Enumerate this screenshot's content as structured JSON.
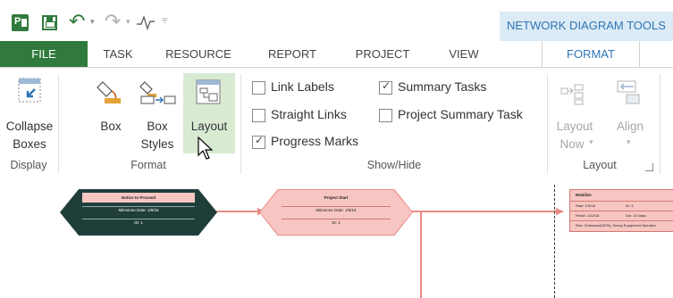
{
  "contextual_title": "NETWORK DIAGRAM TOOLS",
  "tabs": {
    "file": "FILE",
    "task": "TASK",
    "resource": "RESOURCE",
    "report": "REPORT",
    "project": "PROJECT",
    "view": "VIEW",
    "format": "FORMAT"
  },
  "ribbon": {
    "collapse_line1": "Collapse",
    "collapse_line2": "Boxes",
    "box": "Box",
    "box_styles_line1": "Box",
    "box_styles_line2": "Styles",
    "layout": "Layout",
    "link_labels": "Link Labels",
    "straight_links": "Straight Links",
    "progress_marks": "Progress Marks",
    "summary_tasks": "Summary Tasks",
    "project_summary_task": "Project Summary Task",
    "layout_now_line1": "Layout",
    "layout_now_line2": "Now",
    "align": "Align",
    "groups": {
      "display": "Display",
      "format": "Format",
      "show_hide": "Show/Hide",
      "layout": "Layout"
    }
  },
  "checkboxes": {
    "link_labels": false,
    "straight_links": false,
    "progress_marks": true,
    "summary_tasks": true,
    "project_summary_task": false
  },
  "nodes": {
    "node1": {
      "title": "Notice to Proceed",
      "row1": "Milestone Date: 1/8/18",
      "row2": "ID: 1"
    },
    "node2": {
      "title": "Project Start",
      "row1": "Milestone Date: 1/8/18",
      "row2": "ID: 2"
    },
    "node3": {
      "title": "Mobilize",
      "start": "Start: 1/9/18",
      "id": "ID: 3",
      "finish": "Finish: 1/22/18",
      "dur": "Dur: 10 days",
      "res": "Res: Chairman[100%], Heavy Equipment Operator"
    }
  },
  "colors": {
    "file_tab": "#2f7a3c",
    "accent": "#2e75b6",
    "milestone_dark": "#1f3e3a",
    "node_pink": "#f8c6c2",
    "link": "#e88b85"
  }
}
